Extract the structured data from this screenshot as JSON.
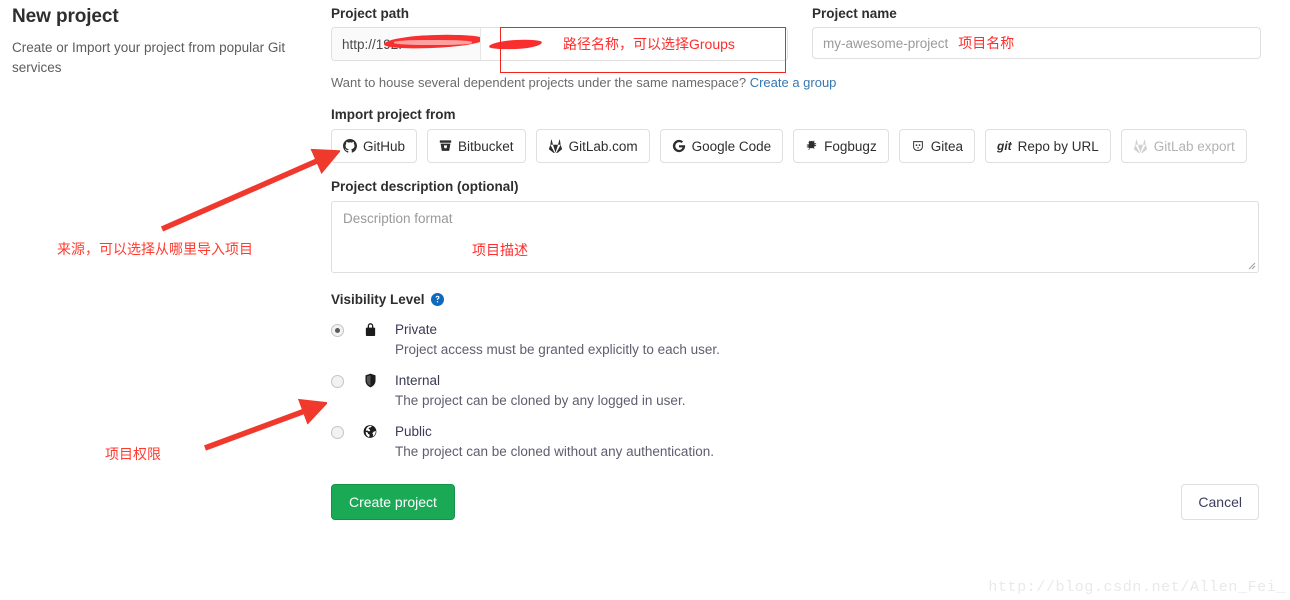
{
  "intro": {
    "title": "New project",
    "subtitle": "Create or Import your project from popular Git services"
  },
  "project_path": {
    "label": "Project path",
    "prefix_value": "http://192.",
    "namespace_value": "",
    "annotation": "路径名称，可以选择Groups",
    "highlight_color": "#f0261f",
    "redacted": true
  },
  "project_name": {
    "label": "Project name",
    "placeholder": "my-awesome-project",
    "value": "",
    "annotation": "项目名称"
  },
  "namespace_hint": {
    "text": "Want to house several dependent projects under the same namespace?",
    "link_label": "Create a group",
    "link_color": "#3777b0"
  },
  "import": {
    "label": "Import project from",
    "buttons": [
      {
        "label": "GitHub",
        "icon": "github-icon",
        "disabled": false
      },
      {
        "label": "Bitbucket",
        "icon": "bitbucket-icon",
        "disabled": false
      },
      {
        "label": "GitLab.com",
        "icon": "gitlab-icon",
        "disabled": false
      },
      {
        "label": "Google Code",
        "icon": "google-icon",
        "disabled": false
      },
      {
        "label": "Fogbugz",
        "icon": "fogbugz-bug-icon",
        "disabled": false
      },
      {
        "label": "Gitea",
        "icon": "gitea-icon",
        "disabled": false
      },
      {
        "label": "Repo by URL",
        "icon": "git-icon",
        "disabled": false
      },
      {
        "label": "GitLab export",
        "icon": "gitlab-icon",
        "disabled": true
      }
    ]
  },
  "description": {
    "label": "Project description (optional)",
    "placeholder": "Description format",
    "value": "",
    "annotation": "项目描述"
  },
  "visibility": {
    "label": "Visibility Level",
    "help_icon": "question-circle-icon",
    "selected": "Private",
    "options": [
      {
        "name": "Private",
        "icon": "lock-icon",
        "description": "Project access must be granted explicitly to each user.",
        "checked": true
      },
      {
        "name": "Internal",
        "icon": "shield-icon",
        "description": "The project can be cloned by any logged in user.",
        "checked": false
      },
      {
        "name": "Public",
        "icon": "globe-icon",
        "description": "The project can be cloned without any authentication.",
        "checked": false
      }
    ]
  },
  "footer": {
    "create_label": "Create project",
    "cancel_label": "Cancel",
    "create_color": "#1aaa55"
  },
  "annotations": {
    "source": "来源，可以选择从哪里导入项目",
    "permission": "项目权限",
    "color": "#ff3b30"
  },
  "watermark": "http://blog.csdn.net/Allen_Fei_"
}
